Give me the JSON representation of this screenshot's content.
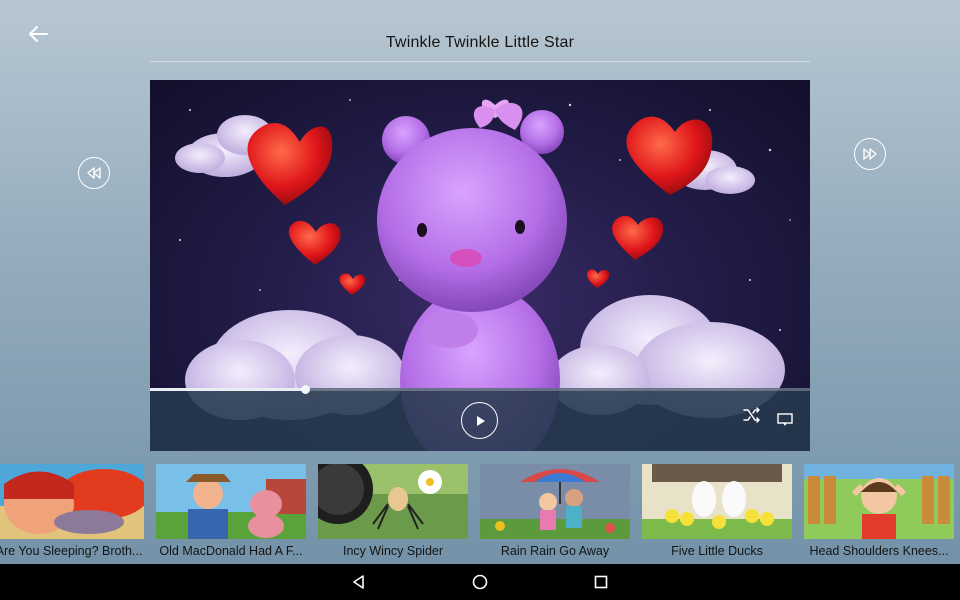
{
  "header": {
    "title": "Twinkle Twinkle Little Star",
    "back_icon": "arrow-left-icon"
  },
  "player": {
    "progress_percent": 23.5,
    "prev_icon": "skip-previous-icon",
    "next_icon": "skip-next-icon",
    "play_icon": "play-icon",
    "shuffle_icon": "shuffle-icon",
    "cast_icon": "cast-icon"
  },
  "videos": [
    {
      "title": "Are You Sleeping? Broth..."
    },
    {
      "title": "Old MacDonald Had A F..."
    },
    {
      "title": "Incy Wincy Spider"
    },
    {
      "title": "Rain Rain Go Away"
    },
    {
      "title": "Five Little Ducks"
    },
    {
      "title": "Head Shoulders Knees..."
    }
  ],
  "navbar": {
    "back_icon": "nav-back-icon",
    "home_icon": "nav-home-icon",
    "recents_icon": "nav-recents-icon"
  },
  "colors": {
    "background_top": "#b7c7d2",
    "background_bottom": "#6f8fa6",
    "controls": "#263a4e",
    "navbar": "#000000"
  }
}
